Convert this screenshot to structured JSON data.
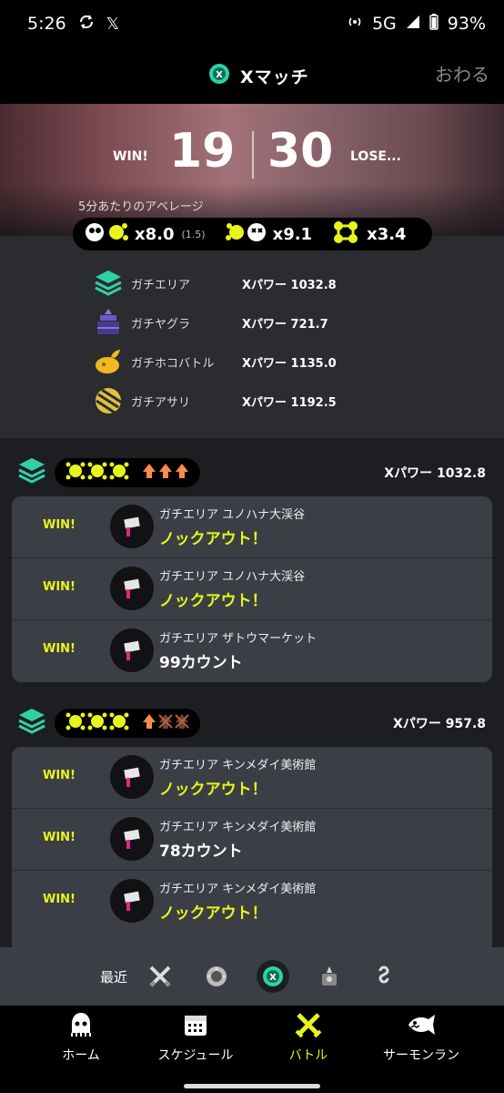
{
  "status_bar": {
    "time": "5:26",
    "network": "5G",
    "battery": "93%"
  },
  "header": {
    "title": "Xマッチ",
    "close_label": "おわる"
  },
  "summary": {
    "win_label": "WIN!",
    "wins": "19",
    "losses": "30",
    "lose_label": "LOSE...",
    "avg_caption": "5分あたりのアベレージ",
    "kills": "x8.0",
    "assists": "(1.5)",
    "deaths": "x9.1",
    "specials": "x3.4"
  },
  "modes": [
    {
      "name": "ガチエリア",
      "power": "Xパワー 1032.8",
      "icon": "splat-zones-icon"
    },
    {
      "name": "ガチヤグラ",
      "power": "Xパワー 721.7",
      "icon": "tower-control-icon"
    },
    {
      "name": "ガチホコバトル",
      "power": "Xパワー 1135.0",
      "icon": "rainmaker-icon"
    },
    {
      "name": "ガチアサリ",
      "power": "Xパワー 1192.5",
      "icon": "clam-blitz-icon"
    }
  ],
  "sets": [
    {
      "power": "Xパワー 1032.8",
      "matches": [
        {
          "result": "WIN!",
          "stage": "ガチエリア ユノハナ大渓谷",
          "outcome": "ノックアウト！"
        },
        {
          "result": "WIN!",
          "stage": "ガチエリア ユノハナ大渓谷",
          "outcome": "ノックアウト！"
        },
        {
          "result": "WIN!",
          "stage": "ガチエリア ザトウマーケット",
          "outcome": "99カウント"
        }
      ]
    },
    {
      "power": "Xパワー 957.8",
      "matches": [
        {
          "result": "WIN!",
          "stage": "ガチエリア キンメダイ美術館",
          "outcome": "ノックアウト！"
        },
        {
          "result": "WIN!",
          "stage": "ガチエリア キンメダイ美術館",
          "outcome": "78カウント"
        },
        {
          "result": "WIN!",
          "stage": "ガチエリア キンメダイ美術館",
          "outcome": "ノックアウト！"
        }
      ]
    }
  ],
  "recent": {
    "label": "最近"
  },
  "nav": [
    {
      "label": "ホーム",
      "icon": "squid-home-icon"
    },
    {
      "label": "スケジュール",
      "icon": "calendar-icon"
    },
    {
      "label": "バトル",
      "icon": "battle-icon"
    },
    {
      "label": "サーモンラン",
      "icon": "salmon-icon"
    }
  ],
  "colors": {
    "accent": "#e8f51c",
    "card": "#3b3e45",
    "zones": "#2fd2a8",
    "orange": "#ff8a4c"
  }
}
